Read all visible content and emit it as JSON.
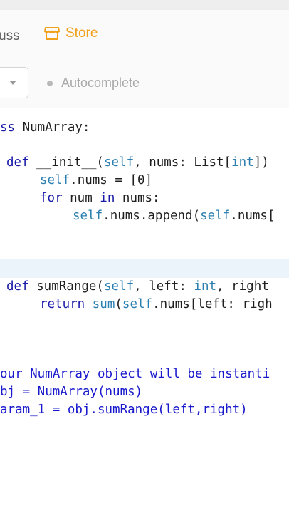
{
  "nav": {
    "discuss_label": "uss",
    "store_label": "Store"
  },
  "toolbar": {
    "autocomplete_label": "Autocomplete"
  },
  "code": {
    "l1_kw": "ss",
    "l1_rest": " NumArray:",
    "l2_def": "def",
    "l2_name": " __init__(",
    "l2_self": "self",
    "l2_mid": ", nums: List[",
    "l2_int": "int",
    "l2_end": "])",
    "l3_self": "self",
    "l3_rest": ".nums = [0]",
    "l4_for": "for",
    "l4_mid": " num ",
    "l4_in": "in",
    "l4_rest": " nums:",
    "l5_self": "self",
    "l5_mid": ".nums.append(",
    "l5_self2": "self",
    "l5_rest": ".nums[",
    "l6_def": "def",
    "l6_name": " sumRange(",
    "l6_self": "self",
    "l6_mid": ", left: ",
    "l6_int": "int",
    "l6_rest": ", right",
    "l7_ret": "return",
    "l7_sp": " ",
    "l7_sum": "sum",
    "l7_paren": "(",
    "l7_self": "self",
    "l7_rest": ".nums[left: righ",
    "c1": "our NumArray object will be instanti",
    "c2": "bj = NumArray(nums)",
    "c3": "aram_1 = obj.sumRange(left,right)"
  }
}
